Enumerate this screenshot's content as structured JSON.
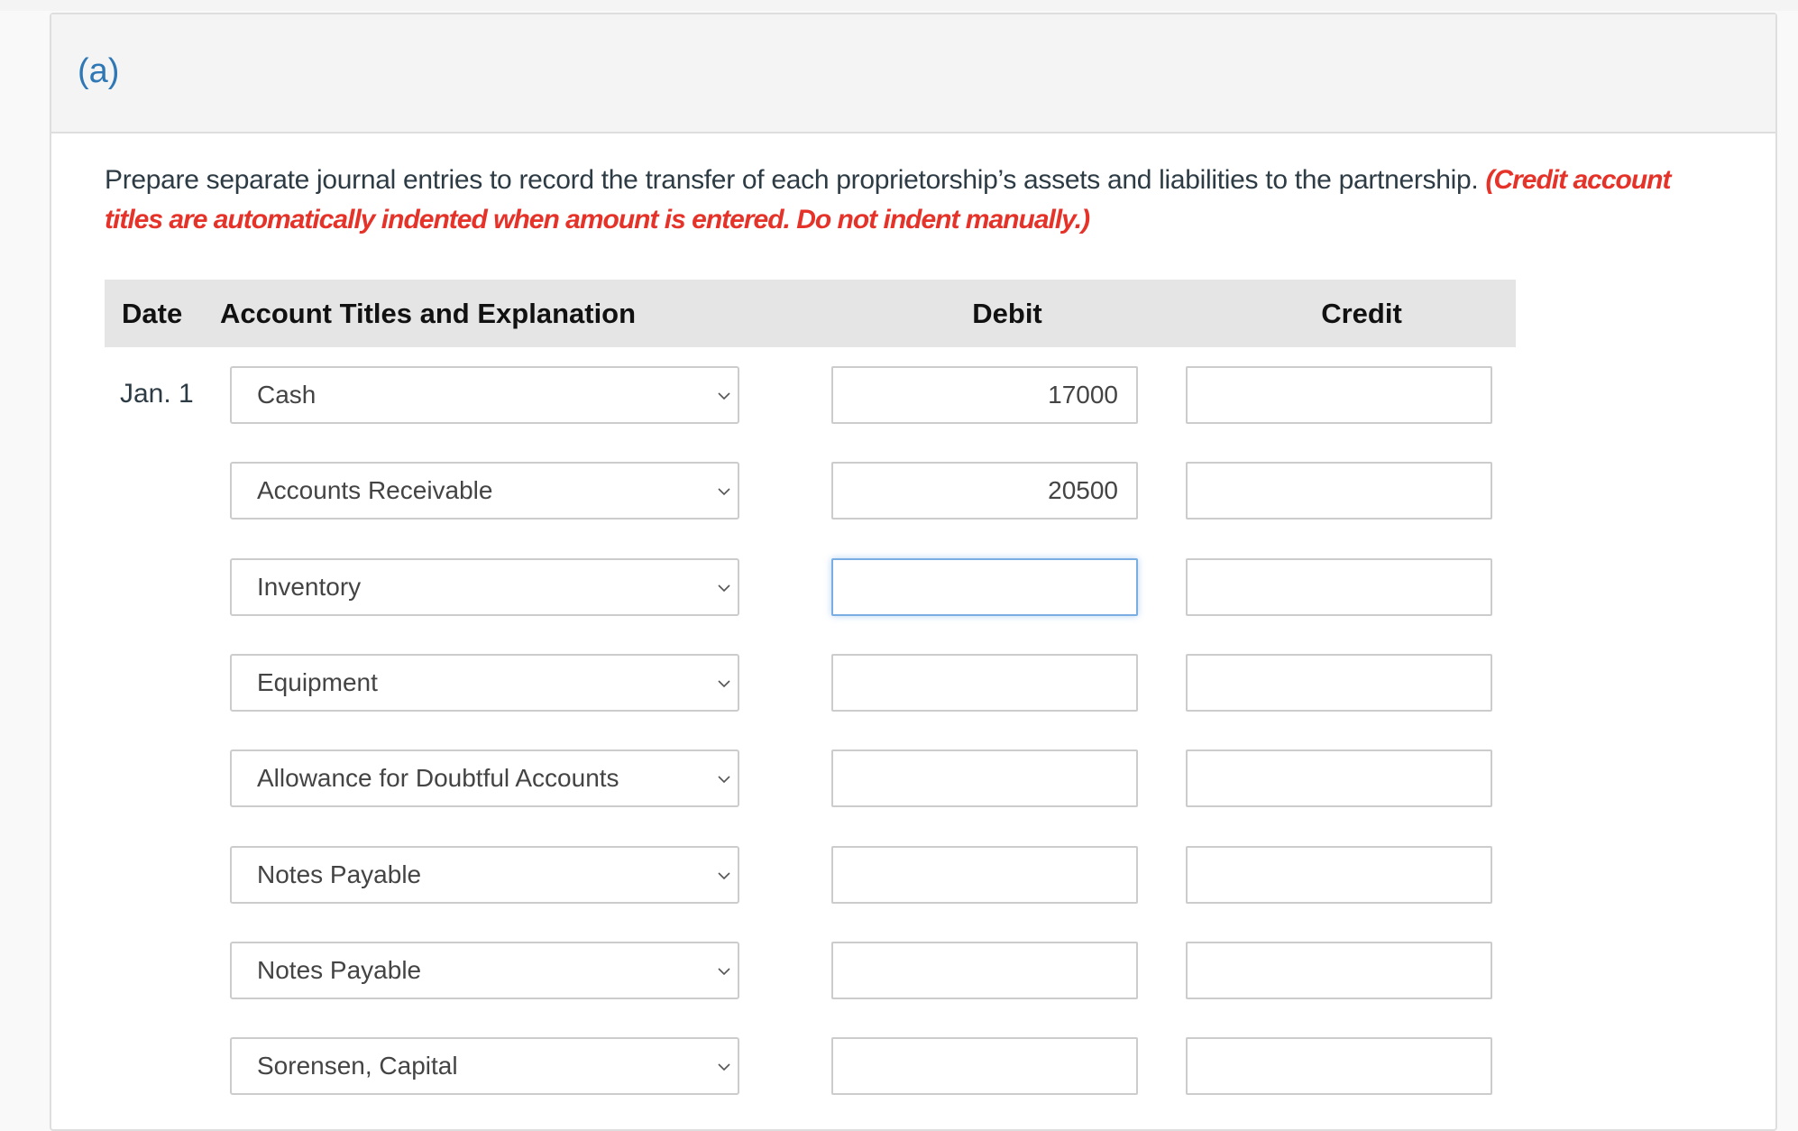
{
  "part": {
    "label": "(a)"
  },
  "instructions": {
    "text": "Prepare separate journal entries to record the transfer of each proprietorship’s assets and liabilities to the partnership.",
    "note": "(Credit account titles are automatically indented when amount is entered. Do not indent manually.)"
  },
  "table": {
    "headers": {
      "date": "Date",
      "account": "Account Titles and Explanation",
      "debit": "Debit",
      "credit": "Credit"
    },
    "rows": [
      {
        "date": "Jan. 1",
        "account": "Cash",
        "debit": "17000",
        "credit": ""
      },
      {
        "date": "",
        "account": "Accounts Receivable",
        "debit": "20500",
        "credit": ""
      },
      {
        "date": "",
        "account": "Inventory",
        "debit": "",
        "credit": "",
        "debit_focused": true
      },
      {
        "date": "",
        "account": "Equipment",
        "debit": "",
        "credit": ""
      },
      {
        "date": "",
        "account": "Allowance for Doubtful Accounts",
        "debit": "",
        "credit": ""
      },
      {
        "date": "",
        "account": "Notes Payable",
        "debit": "",
        "credit": ""
      },
      {
        "date": "",
        "account": "Notes Payable",
        "debit": "",
        "credit": ""
      },
      {
        "date": "",
        "account": "Sorensen, Capital",
        "debit": "",
        "credit": ""
      }
    ]
  },
  "colors": {
    "part_label": "#2f78b5",
    "note": "#e5332a",
    "focus_border": "#7aade1"
  }
}
